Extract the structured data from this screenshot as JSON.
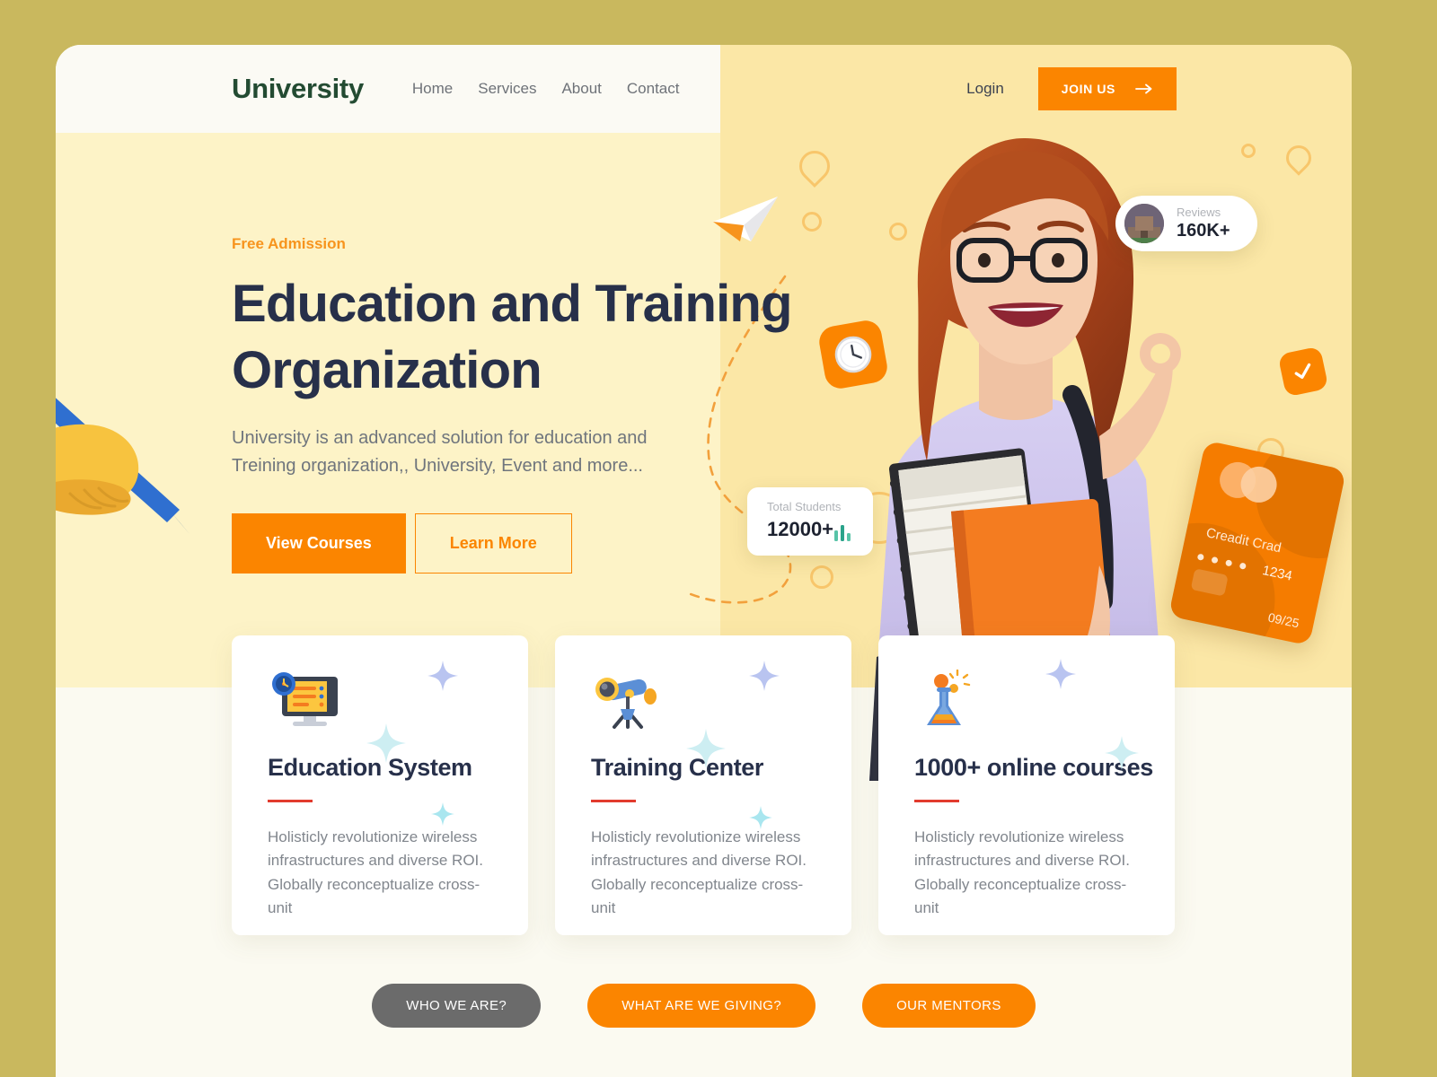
{
  "theme": {
    "page_background": "#c9b85e",
    "hero_left_background": "#fdf3c7",
    "hero_right_background": "#fbe7a6",
    "lower_background": "#fbfaf1",
    "accent_orange": "#fb8500",
    "logo_green": "#234b32",
    "heading_navy": "#27304a",
    "rule_red": "#e23b2e",
    "pill_gray": "#6b6b6b"
  },
  "header": {
    "logo": "University",
    "nav": [
      {
        "label": "Home"
      },
      {
        "label": "Services"
      },
      {
        "label": "About"
      },
      {
        "label": "Contact"
      }
    ],
    "login_label": "Login",
    "join_label": "JOIN US",
    "join_icon": "arrow-right-icon"
  },
  "hero": {
    "eyebrow": "Free Admission",
    "title": "Education and Training Organization",
    "subtitle": "University is an advanced solution for education and Treining organization,, University, Event and more...",
    "primary_button": "View Courses",
    "secondary_button": "Learn More",
    "decorations": {
      "clock_badge": "clock-icon",
      "check_badge": "check-icon",
      "paper_plane": "paper-plane-icon",
      "dashed_path": "dashed-curve",
      "hand_pen": "hand-writing-illustration"
    }
  },
  "stats": {
    "reviews": {
      "label": "Reviews",
      "value": "160K+",
      "thumbnail": "campus-building-photo"
    },
    "students": {
      "label": "Total Students",
      "value": "12000+",
      "chart_icon": "bar-chart-icon",
      "chart_color": "#2aa38a"
    },
    "credit_card": {
      "name": "Creadit Crad",
      "masked_digits": "• • • •",
      "last_four": "1234",
      "expiry": "09/25"
    }
  },
  "features": [
    {
      "icon": "monitor-clock-icon",
      "title": "Education System",
      "text": "Holisticly revolutionize wireless infrastructures and diverse ROI. Globally reconceptualize cross-unit"
    },
    {
      "icon": "telescope-icon",
      "title": "Training Center",
      "text": "Holisticly revolutionize wireless infrastructures and diverse ROI. Globally reconceptualize cross-unit"
    },
    {
      "icon": "flask-icon",
      "title": "1000+ online courses",
      "text": "Holisticly revolutionize wireless infrastructures and diverse ROI. Globally reconceptualize cross-unit"
    }
  ],
  "pills": [
    {
      "label": "WHO WE ARE?",
      "style": "gray"
    },
    {
      "label": "WHAT ARE WE GIVING?",
      "style": "orange"
    },
    {
      "label": "OUR MENTORS",
      "style": "orange"
    }
  ]
}
